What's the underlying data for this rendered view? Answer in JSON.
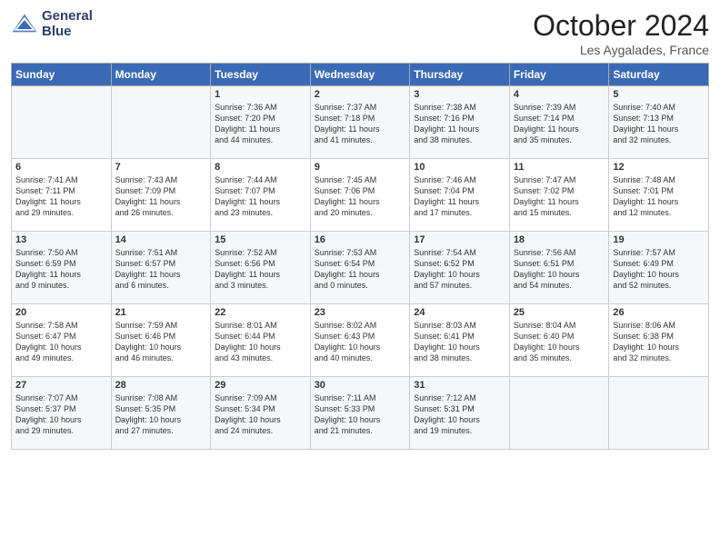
{
  "logo": {
    "line1": "General",
    "line2": "Blue"
  },
  "title": "October 2024",
  "location": "Les Aygalades, France",
  "days_of_week": [
    "Sunday",
    "Monday",
    "Tuesday",
    "Wednesday",
    "Thursday",
    "Friday",
    "Saturday"
  ],
  "weeks": [
    [
      {
        "day": "",
        "info": ""
      },
      {
        "day": "",
        "info": ""
      },
      {
        "day": "1",
        "info": "Sunrise: 7:36 AM\nSunset: 7:20 PM\nDaylight: 11 hours\nand 44 minutes."
      },
      {
        "day": "2",
        "info": "Sunrise: 7:37 AM\nSunset: 7:18 PM\nDaylight: 11 hours\nand 41 minutes."
      },
      {
        "day": "3",
        "info": "Sunrise: 7:38 AM\nSunset: 7:16 PM\nDaylight: 11 hours\nand 38 minutes."
      },
      {
        "day": "4",
        "info": "Sunrise: 7:39 AM\nSunset: 7:14 PM\nDaylight: 11 hours\nand 35 minutes."
      },
      {
        "day": "5",
        "info": "Sunrise: 7:40 AM\nSunset: 7:13 PM\nDaylight: 11 hours\nand 32 minutes."
      }
    ],
    [
      {
        "day": "6",
        "info": "Sunrise: 7:41 AM\nSunset: 7:11 PM\nDaylight: 11 hours\nand 29 minutes."
      },
      {
        "day": "7",
        "info": "Sunrise: 7:43 AM\nSunset: 7:09 PM\nDaylight: 11 hours\nand 26 minutes."
      },
      {
        "day": "8",
        "info": "Sunrise: 7:44 AM\nSunset: 7:07 PM\nDaylight: 11 hours\nand 23 minutes."
      },
      {
        "day": "9",
        "info": "Sunrise: 7:45 AM\nSunset: 7:06 PM\nDaylight: 11 hours\nand 20 minutes."
      },
      {
        "day": "10",
        "info": "Sunrise: 7:46 AM\nSunset: 7:04 PM\nDaylight: 11 hours\nand 17 minutes."
      },
      {
        "day": "11",
        "info": "Sunrise: 7:47 AM\nSunset: 7:02 PM\nDaylight: 11 hours\nand 15 minutes."
      },
      {
        "day": "12",
        "info": "Sunrise: 7:48 AM\nSunset: 7:01 PM\nDaylight: 11 hours\nand 12 minutes."
      }
    ],
    [
      {
        "day": "13",
        "info": "Sunrise: 7:50 AM\nSunset: 6:59 PM\nDaylight: 11 hours\nand 9 minutes."
      },
      {
        "day": "14",
        "info": "Sunrise: 7:51 AM\nSunset: 6:57 PM\nDaylight: 11 hours\nand 6 minutes."
      },
      {
        "day": "15",
        "info": "Sunrise: 7:52 AM\nSunset: 6:56 PM\nDaylight: 11 hours\nand 3 minutes."
      },
      {
        "day": "16",
        "info": "Sunrise: 7:53 AM\nSunset: 6:54 PM\nDaylight: 11 hours\nand 0 minutes."
      },
      {
        "day": "17",
        "info": "Sunrise: 7:54 AM\nSunset: 6:52 PM\nDaylight: 10 hours\nand 57 minutes."
      },
      {
        "day": "18",
        "info": "Sunrise: 7:56 AM\nSunset: 6:51 PM\nDaylight: 10 hours\nand 54 minutes."
      },
      {
        "day": "19",
        "info": "Sunrise: 7:57 AM\nSunset: 6:49 PM\nDaylight: 10 hours\nand 52 minutes."
      }
    ],
    [
      {
        "day": "20",
        "info": "Sunrise: 7:58 AM\nSunset: 6:47 PM\nDaylight: 10 hours\nand 49 minutes."
      },
      {
        "day": "21",
        "info": "Sunrise: 7:59 AM\nSunset: 6:46 PM\nDaylight: 10 hours\nand 46 minutes."
      },
      {
        "day": "22",
        "info": "Sunrise: 8:01 AM\nSunset: 6:44 PM\nDaylight: 10 hours\nand 43 minutes."
      },
      {
        "day": "23",
        "info": "Sunrise: 8:02 AM\nSunset: 6:43 PM\nDaylight: 10 hours\nand 40 minutes."
      },
      {
        "day": "24",
        "info": "Sunrise: 8:03 AM\nSunset: 6:41 PM\nDaylight: 10 hours\nand 38 minutes."
      },
      {
        "day": "25",
        "info": "Sunrise: 8:04 AM\nSunset: 6:40 PM\nDaylight: 10 hours\nand 35 minutes."
      },
      {
        "day": "26",
        "info": "Sunrise: 8:06 AM\nSunset: 6:38 PM\nDaylight: 10 hours\nand 32 minutes."
      }
    ],
    [
      {
        "day": "27",
        "info": "Sunrise: 7:07 AM\nSunset: 5:37 PM\nDaylight: 10 hours\nand 29 minutes."
      },
      {
        "day": "28",
        "info": "Sunrise: 7:08 AM\nSunset: 5:35 PM\nDaylight: 10 hours\nand 27 minutes."
      },
      {
        "day": "29",
        "info": "Sunrise: 7:09 AM\nSunset: 5:34 PM\nDaylight: 10 hours\nand 24 minutes."
      },
      {
        "day": "30",
        "info": "Sunrise: 7:11 AM\nSunset: 5:33 PM\nDaylight: 10 hours\nand 21 minutes."
      },
      {
        "day": "31",
        "info": "Sunrise: 7:12 AM\nSunset: 5:31 PM\nDaylight: 10 hours\nand 19 minutes."
      },
      {
        "day": "",
        "info": ""
      },
      {
        "day": "",
        "info": ""
      }
    ]
  ]
}
